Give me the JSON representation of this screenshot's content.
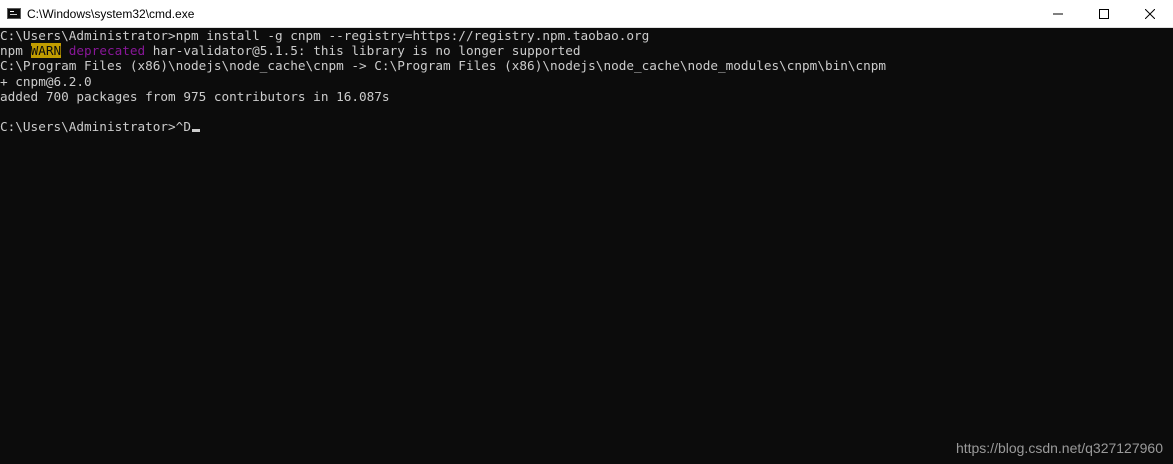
{
  "window": {
    "title": "C:\\Windows\\system32\\cmd.exe",
    "controls": {
      "minimize": "minimize",
      "maximize": "maximize",
      "close": "close"
    }
  },
  "terminal": {
    "lines": [
      {
        "segments": [
          {
            "text": "C:\\Users\\Administrator>npm install -g cnpm --registry=https://registry.npm.taobao.org",
            "style": "normal"
          }
        ]
      },
      {
        "segments": [
          {
            "text": "npm ",
            "style": "normal"
          },
          {
            "text": "WARN",
            "style": "warn"
          },
          {
            "text": " ",
            "style": "normal"
          },
          {
            "text": "deprecated",
            "style": "deprecated"
          },
          {
            "text": " har-validator@5.1.5: this library is no longer supported",
            "style": "normal"
          }
        ]
      },
      {
        "segments": [
          {
            "text": "C:\\Program Files (x86)\\nodejs\\node_cache\\cnpm -> C:\\Program Files (x86)\\nodejs\\node_cache\\node_modules\\cnpm\\bin\\cnpm",
            "style": "normal"
          }
        ]
      },
      {
        "segments": [
          {
            "text": "+ cnpm@6.2.0",
            "style": "normal"
          }
        ]
      },
      {
        "segments": [
          {
            "text": "added 700 packages from 975 contributors in 16.087s",
            "style": "normal"
          }
        ]
      },
      {
        "segments": [
          {
            "text": "",
            "style": "normal"
          }
        ]
      },
      {
        "segments": [
          {
            "text": "C:\\Users\\Administrator>^D",
            "style": "normal"
          }
        ],
        "cursor": true
      }
    ]
  },
  "watermark": "https://blog.csdn.net/q327127960",
  "colors": {
    "background": "#0c0c0c",
    "foreground": "#cccccc",
    "warn_bg": "#c19c00",
    "deprecated": "#881798"
  }
}
